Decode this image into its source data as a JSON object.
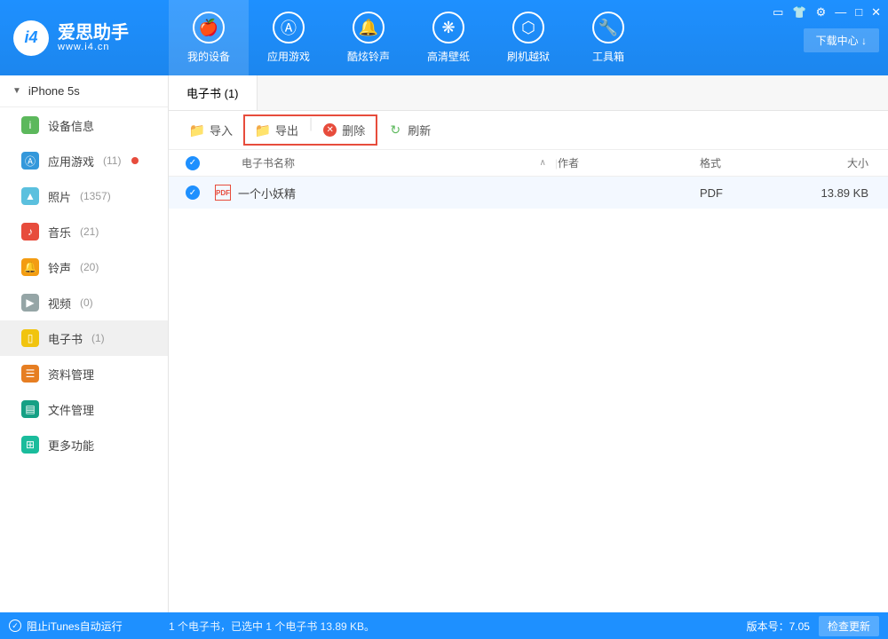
{
  "header": {
    "logo_char": "i4",
    "logo_title": "爱思助手",
    "logo_sub": "www.i4.cn",
    "download_label": "下载中心 ↓",
    "nav": [
      {
        "label": "我的设备",
        "glyph": "🍎"
      },
      {
        "label": "应用游戏",
        "glyph": "Ⓐ"
      },
      {
        "label": "酷炫铃声",
        "glyph": "🔔"
      },
      {
        "label": "高清壁纸",
        "glyph": "❋"
      },
      {
        "label": "刷机越狱",
        "glyph": "⬡"
      },
      {
        "label": "工具箱",
        "glyph": "🔧"
      }
    ]
  },
  "sidebar": {
    "device": "iPhone 5s",
    "items": [
      {
        "label": "设备信息",
        "count": "",
        "dot": false
      },
      {
        "label": "应用游戏",
        "count": "(11)",
        "dot": true
      },
      {
        "label": "照片",
        "count": "(1357)",
        "dot": false
      },
      {
        "label": "音乐",
        "count": "(21)",
        "dot": false
      },
      {
        "label": "铃声",
        "count": "(20)",
        "dot": false
      },
      {
        "label": "视频",
        "count": "(0)",
        "dot": false
      },
      {
        "label": "电子书",
        "count": "(1)",
        "dot": false
      },
      {
        "label": "资料管理",
        "count": "",
        "dot": false
      },
      {
        "label": "文件管理",
        "count": "",
        "dot": false
      },
      {
        "label": "更多功能",
        "count": "",
        "dot": false
      }
    ]
  },
  "main": {
    "tab_label": "电子书 (1)",
    "toolbar": {
      "import": "导入",
      "export": "导出",
      "delete": "删除",
      "refresh": "刷新"
    },
    "columns": {
      "name": "电子书名称",
      "author": "作者",
      "format": "格式",
      "size": "大小"
    },
    "rows": [
      {
        "name": "一个小妖精",
        "author": "",
        "format": "PDF",
        "size": "13.89 KB"
      }
    ]
  },
  "footer": {
    "itunes": "阻止iTunes自动运行",
    "status": "1 个电子书，已选中 1 个电子书 13.89 KB。",
    "version_label": "版本号：7.05",
    "update": "检查更新"
  }
}
